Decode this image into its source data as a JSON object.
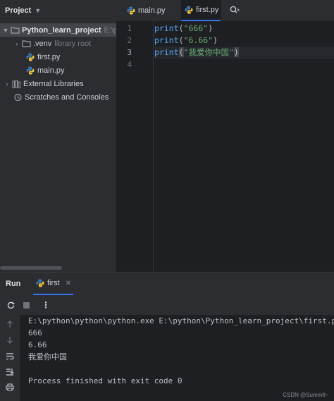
{
  "project": {
    "header": "Project",
    "tree": [
      {
        "label": "Python_learn_project",
        "suffix": "E:\\py",
        "icon": "folder-icon"
      },
      {
        "label": ".venv",
        "suffix": "library root",
        "icon": "folder-icon"
      },
      {
        "label": "first.py",
        "icon": "python-file-icon"
      },
      {
        "label": "main.py",
        "icon": "python-file-icon"
      },
      {
        "label": "External Libraries",
        "icon": "libraries-icon"
      },
      {
        "label": "Scratches and Consoles",
        "icon": "scratches-icon"
      }
    ]
  },
  "editor": {
    "tabs": [
      "main.py",
      "first.py"
    ],
    "line_numbers": [
      "1",
      "2",
      "3",
      "4"
    ],
    "lines": [
      {
        "fn": "print",
        "open": "(",
        "str": "\"666\"",
        "close": ")"
      },
      {
        "fn": "print",
        "open": "(",
        "str": "\"6.66\"",
        "close": ")"
      },
      {
        "fn": "print",
        "open": "(",
        "str": "\"我爱你中国\"",
        "close": ")"
      }
    ]
  },
  "run": {
    "title": "Run",
    "tab": "first",
    "output": [
      "E:\\python\\python\\python.exe E:\\python\\Python_learn_project\\first.py",
      "666",
      "6.66",
      "我爱你中国",
      "",
      "Process finished with exit code 0"
    ]
  },
  "watermark": "CSDN @Summit~",
  "colors": {
    "accent": "#3574f0",
    "keyword_fn": "#56a8f5",
    "string": "#6aab73",
    "python_blue": "#3d7ab8",
    "python_yellow": "#f0c43c"
  }
}
